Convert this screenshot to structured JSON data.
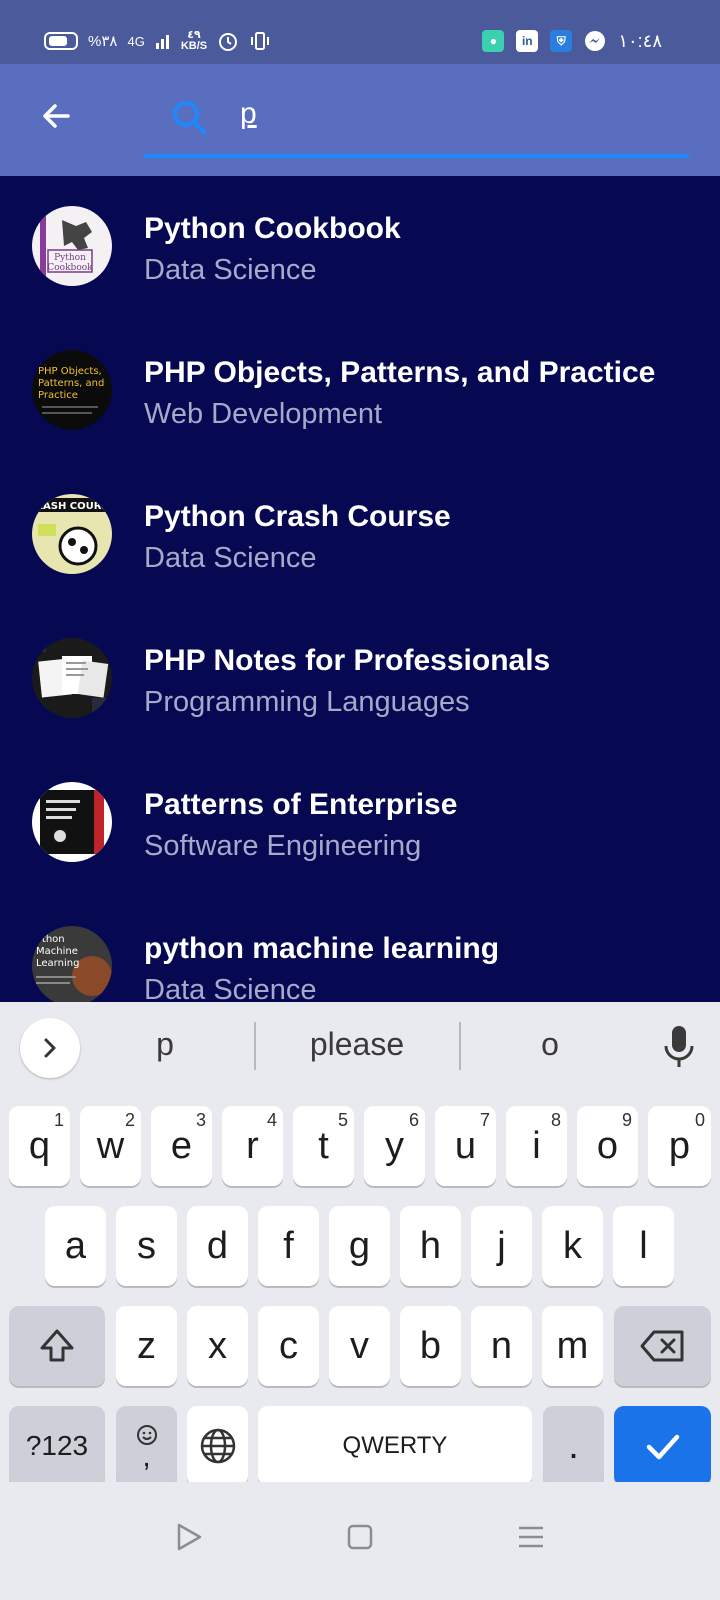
{
  "status_bar": {
    "battery_text": "%٣٨",
    "network": "4G",
    "net_speed_value": "٤٩",
    "net_speed_unit": "KB/S",
    "time": "١٠:٤٨"
  },
  "search": {
    "query": "p"
  },
  "results": [
    {
      "title": "Python Cookbook",
      "category": "Data Science",
      "cover_text": "Python Cookbook",
      "cover_bg": "#f4f1f4",
      "cover_fg": "#7a3b8a"
    },
    {
      "title": "PHP Objects, Patterns, and Practice",
      "category": "Web Development",
      "cover_text": "PHP Objects, Patterns, and Practice",
      "cover_bg": "#0b0b0b",
      "cover_fg": "#f2c230"
    },
    {
      "title": "Python Crash Course",
      "category": "Data Science",
      "cover_text": "RASH COURS",
      "cover_bg": "#e8e6b0",
      "cover_fg": "#111111"
    },
    {
      "title": "PHP Notes for Professionals",
      "category": "Programming Languages",
      "cover_text": "",
      "cover_bg": "#1a1a1a",
      "cover_fg": "#ffffff"
    },
    {
      "title": "Patterns of Enterprise",
      "category": "Software Engineering",
      "cover_text": "",
      "cover_bg": "#ffffff",
      "cover_fg": "#c0242b"
    },
    {
      "title": "python machine learning",
      "category": "Data Science",
      "cover_text": "ython Machine Learning",
      "cover_bg": "#3b3a3a",
      "cover_fg": "#ffffff"
    }
  ],
  "keyboard": {
    "suggestions": [
      "p",
      "please",
      "o"
    ],
    "row1": [
      {
        "ch": "q",
        "hint": "1"
      },
      {
        "ch": "w",
        "hint": "2"
      },
      {
        "ch": "e",
        "hint": "3"
      },
      {
        "ch": "r",
        "hint": "4"
      },
      {
        "ch": "t",
        "hint": "5"
      },
      {
        "ch": "y",
        "hint": "6"
      },
      {
        "ch": "u",
        "hint": "7"
      },
      {
        "ch": "i",
        "hint": "8"
      },
      {
        "ch": "o",
        "hint": "9"
      },
      {
        "ch": "p",
        "hint": "0"
      }
    ],
    "row2": [
      "a",
      "s",
      "d",
      "f",
      "g",
      "h",
      "j",
      "k",
      "l"
    ],
    "row3": [
      "z",
      "x",
      "c",
      "v",
      "b",
      "n",
      "m"
    ],
    "symbols_label": "?123",
    "comma_label": ",",
    "space_label": "QWERTY",
    "period_label": "."
  },
  "colors": {
    "status_bar": "#4a5a9a",
    "app_bar": "#5a6ec0",
    "list_bg": "#070852",
    "accent": "#1e88ff",
    "subtitle": "#a6a9c9",
    "enter_key": "#1a73e8"
  }
}
